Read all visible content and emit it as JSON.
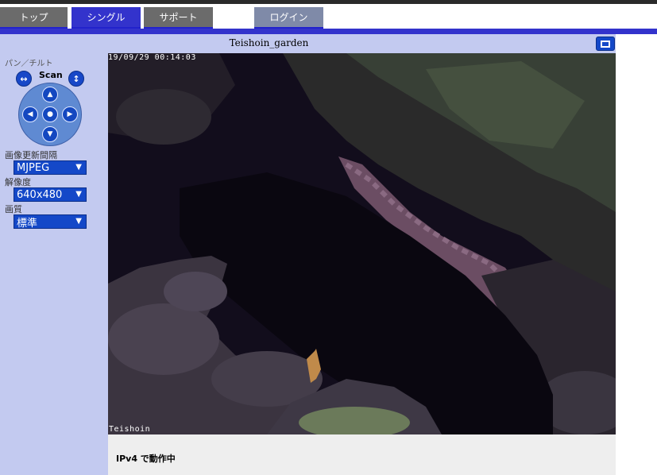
{
  "nav": {
    "tabs": [
      {
        "label": "トップ",
        "active": false
      },
      {
        "label": "シングル",
        "active": true
      },
      {
        "label": "サポート",
        "active": false
      }
    ],
    "login_label": "ログイン"
  },
  "sidebar": {
    "pantilt_label": "パン／チルト",
    "scan_label": "Scan",
    "refresh_label": "画像更新間隔",
    "refresh_value": "MJPEG",
    "resolution_label": "解像度",
    "resolution_value": "640x480",
    "quality_label": "画質",
    "quality_value": "標準"
  },
  "camera": {
    "title": "Teishoin_garden",
    "timestamp": "19/09/29 00:14:03",
    "watermark": "Teishoin"
  },
  "status": {
    "text": "IPv4 で動作中"
  },
  "colors": {
    "accent": "#3333cc",
    "tab_inactive": "#6b6b6b",
    "sidebar_bg": "#c3caf0",
    "control_blue": "#1448c8"
  }
}
